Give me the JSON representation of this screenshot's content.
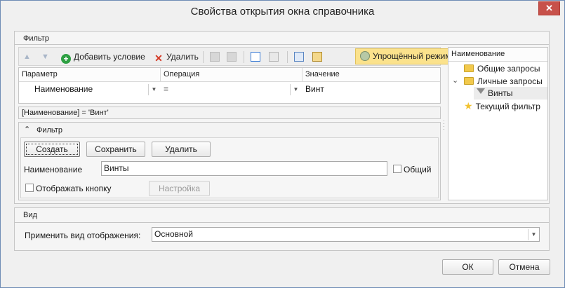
{
  "window": {
    "title": "Свойства открытия окна справочника",
    "close_glyph": "✕"
  },
  "filter_group": {
    "header": "Фильтр",
    "toolbar": {
      "up_glyph": "▲",
      "down_glyph": "▼",
      "add_condition": "Добавить условие",
      "delete": "Удалить",
      "simple_mode": "Упрощённый режим"
    },
    "grid": {
      "columns": [
        "Параметр",
        "Операция",
        "Значение"
      ],
      "row": {
        "parameter": "Наименование",
        "operation": "=",
        "value": "Винт"
      }
    },
    "expression": "[Наименование] = 'Винт'",
    "subpanel": {
      "header": "Фильтр",
      "collapse_glyph": "⌃",
      "create_button": "Создать",
      "save_button": "Сохранить",
      "delete_button": "Удалить",
      "name_label": "Наименование",
      "name_value": "Винты",
      "common_label": "Общий",
      "show_button_label": "Отображать кнопку",
      "settings_button": "Настройка"
    }
  },
  "tree": {
    "header": "Наименование",
    "items": [
      {
        "label": "Общие запросы",
        "icon": "folder-icon"
      },
      {
        "label": "Личные запросы",
        "icon": "folder-icon",
        "expand_glyph": "⌄"
      },
      {
        "label": "Винты",
        "icon": "filter-icon"
      },
      {
        "label": "Текущий фильтр",
        "icon": "star-icon"
      }
    ]
  },
  "view_group": {
    "header": "Вид",
    "apply_label": "Применить вид отображения:",
    "apply_value": "Основной"
  },
  "footer": {
    "ok": "ОК",
    "cancel": "Отмена"
  },
  "colors": {
    "accent_border": "#6e8bb5",
    "close_button": "#c7514a",
    "simple_mode_bg": "#fbe28c"
  }
}
